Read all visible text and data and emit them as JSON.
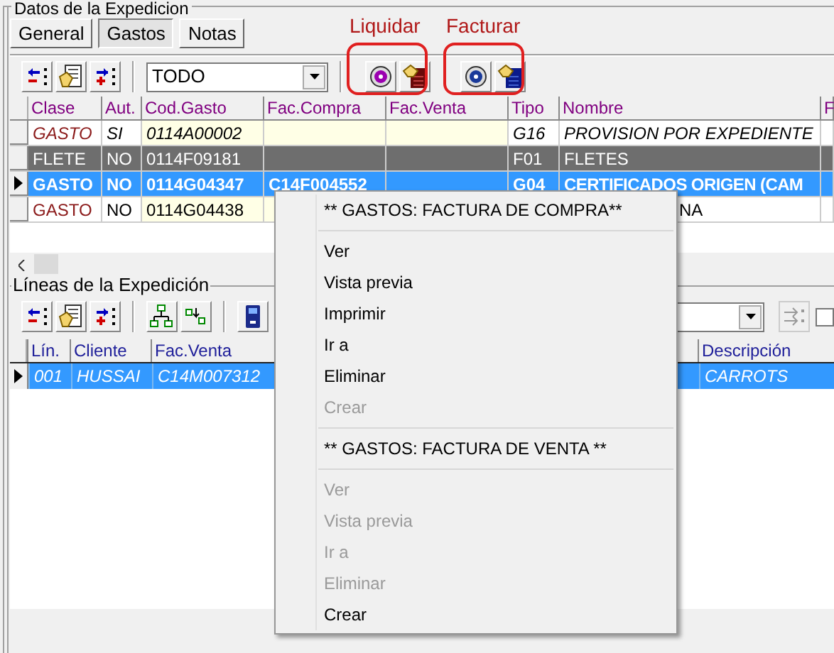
{
  "group_title": "Datos de la Expedicion",
  "tabs": [
    {
      "label": "General",
      "selected": false
    },
    {
      "label": "Gastos",
      "selected": true
    },
    {
      "label": "Notas",
      "selected": false
    }
  ],
  "annotations": [
    {
      "label": "Liquidar"
    },
    {
      "label": "Facturar"
    }
  ],
  "filter": {
    "value": "TODO"
  },
  "gastos_table": {
    "columns": [
      "Clase",
      "Aut.",
      "Cod.Gasto",
      "Fac.Compra",
      "Fac.Venta",
      "Tipo",
      "Nombre",
      "F"
    ],
    "rows": [
      {
        "kind": "italic",
        "selected": false,
        "clase": "GASTO",
        "aut": "SI",
        "cod_gasto": "0114A00002",
        "tipo": "G16",
        "nombre": "PROVISION POR EXPEDIENTE"
      },
      {
        "kind": "dark",
        "selected": false,
        "clase": "FLETE",
        "aut": "NO",
        "cod_gasto": "0114F09181",
        "tipo": "F01",
        "nombre": "FLETES"
      },
      {
        "kind": "normal",
        "selected": true,
        "clase": "GASTO",
        "aut": "NO",
        "cod_gasto": "0114G04347",
        "fac_compra": "C14F004552",
        "tipo": "G04",
        "nombre": "CERTIFICADOS ORIGEN (CAM"
      },
      {
        "kind": "normal",
        "selected": false,
        "clase": "GASTO",
        "aut": "NO",
        "cod_gasto": "0114G04438",
        "nombre": "NA"
      }
    ]
  },
  "lineas_title": "Líneas de la Expedición",
  "option_checkbox": {
    "checked": false
  },
  "lineas_table": {
    "columns": [
      "Lín.",
      "Cliente",
      "Fac.Venta",
      "Descripción"
    ],
    "rows": [
      {
        "selected": true,
        "lin": "001",
        "cliente": "HUSSAI",
        "fac_venta": "C14M007312",
        "descripcion": "CARROTS"
      }
    ]
  },
  "context_menu": [
    {
      "kind": "header",
      "label": "** GASTOS: FACTURA DE COMPRA**"
    },
    {
      "kind": "separator"
    },
    {
      "kind": "item",
      "label": "Ver",
      "disabled": false
    },
    {
      "kind": "item",
      "label": "Vista previa",
      "disabled": false
    },
    {
      "kind": "item",
      "label": "Imprimir",
      "disabled": false
    },
    {
      "kind": "item",
      "label": "Ir a",
      "disabled": false
    },
    {
      "kind": "item",
      "label": "Eliminar",
      "disabled": false
    },
    {
      "kind": "item",
      "label": "Crear",
      "disabled": true
    },
    {
      "kind": "separator"
    },
    {
      "kind": "header",
      "label": "** GASTOS: FACTURA DE VENTA **"
    },
    {
      "kind": "separator"
    },
    {
      "kind": "item",
      "label": "Ver",
      "disabled": true
    },
    {
      "kind": "item",
      "label": "Vista previa",
      "disabled": true
    },
    {
      "kind": "item",
      "label": "Ir a",
      "disabled": true
    },
    {
      "kind": "item",
      "label": "Eliminar",
      "disabled": true
    },
    {
      "kind": "item",
      "label": "Crear",
      "disabled": false
    }
  ]
}
